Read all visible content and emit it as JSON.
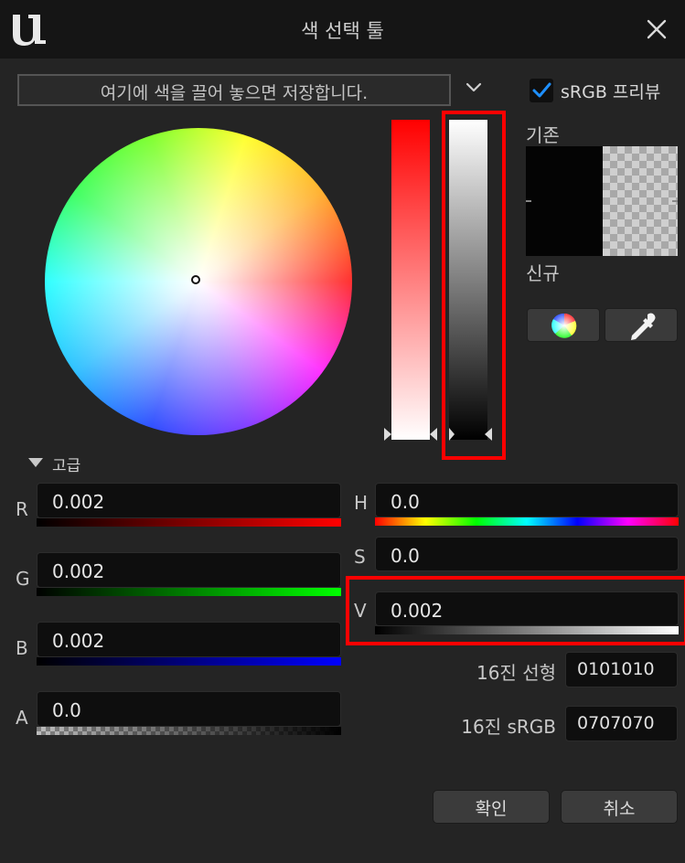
{
  "window": {
    "title": "색 선택 툴"
  },
  "dropzone": {
    "text": "여기에 색을 끌어 놓으면 저장합니다."
  },
  "srgb_preview": {
    "label": "sRGB 프리뷰",
    "checked": true
  },
  "preview": {
    "old_label": "기존",
    "new_label": "신규"
  },
  "advanced": {
    "label": "고급"
  },
  "channels": {
    "r": {
      "label": "R",
      "value": "0.002"
    },
    "g": {
      "label": "G",
      "value": "0.002"
    },
    "b": {
      "label": "B",
      "value": "0.002"
    },
    "a": {
      "label": "A",
      "value": "0.0"
    },
    "h": {
      "label": "H",
      "value": "0.0"
    },
    "s": {
      "label": "S",
      "value": "0.0"
    },
    "v": {
      "label": "V",
      "value": "0.002"
    }
  },
  "hex": {
    "linear_label": "16진 선형",
    "linear_value": "0101010",
    "srgb_label": "16진 sRGB",
    "srgb_value": "0707070"
  },
  "buttons": {
    "ok": "확인",
    "cancel": "취소"
  },
  "colors": {
    "accent_check": "#1e8fff",
    "highlight": "#ff0000",
    "background": "#242424"
  },
  "icons": {
    "logo": "unreal-logo-icon",
    "close": "close-icon",
    "dropdown": "chevron-down-icon",
    "wheel_mode": "color-wheel-icon",
    "eyedropper": "eyedropper-icon"
  }
}
